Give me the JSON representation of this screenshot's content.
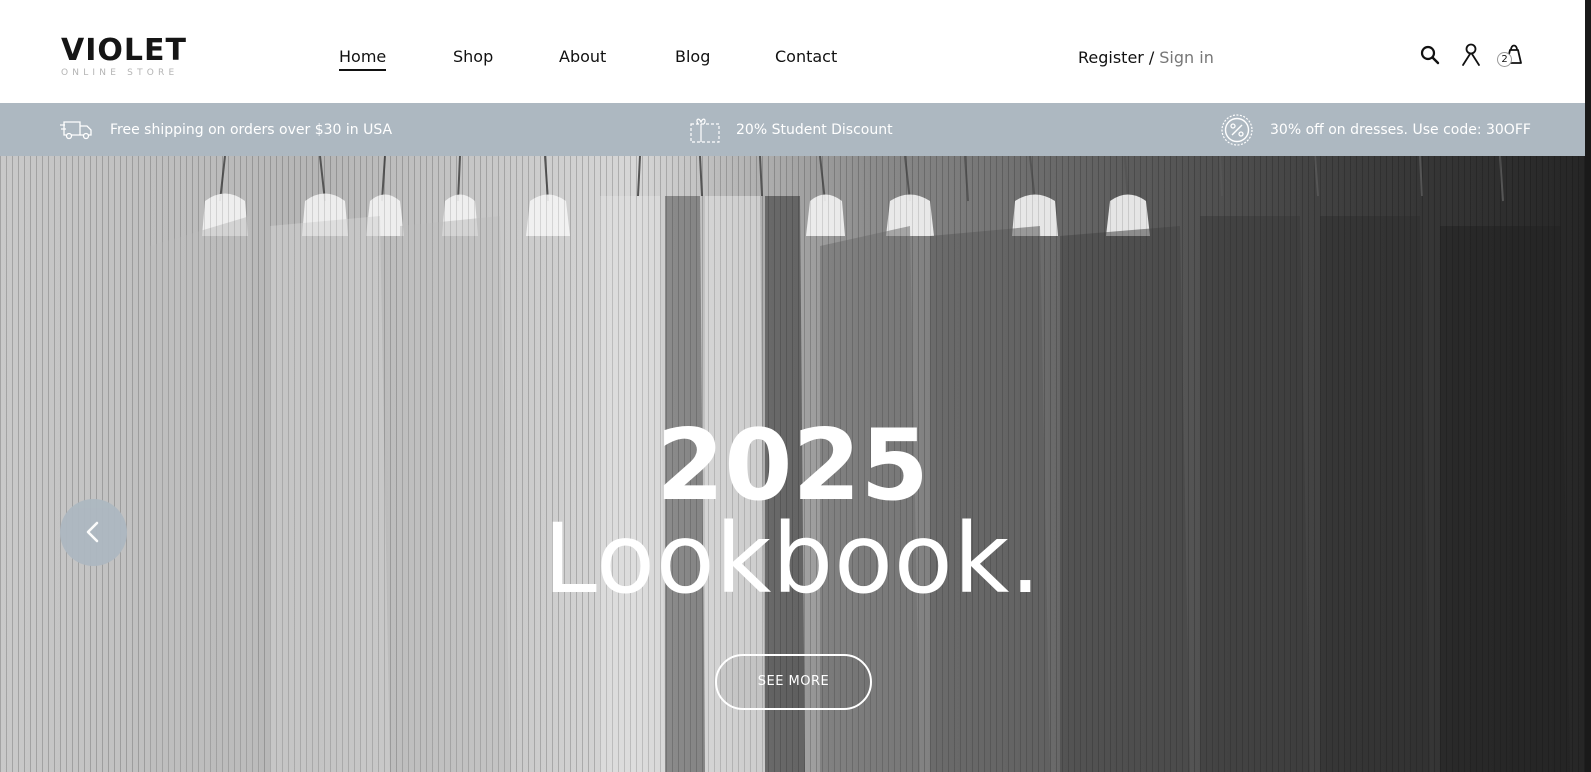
{
  "logo": {
    "title": "VIOLET",
    "subtitle": "ONLINE STORE"
  },
  "nav": {
    "items": [
      {
        "label": "Home",
        "active": true
      },
      {
        "label": "Shop",
        "active": false
      },
      {
        "label": "About",
        "active": false
      },
      {
        "label": "Blog",
        "active": false
      },
      {
        "label": "Contact",
        "active": false
      }
    ]
  },
  "auth": {
    "register": "Register",
    "separator": "/",
    "signin": "Sign in"
  },
  "header_icons": {
    "search": "search-icon",
    "account": "user-icon",
    "cart": "shopping-bag-icon",
    "cart_count": "2"
  },
  "promo": {
    "items": [
      {
        "icon": "delivery-truck-icon",
        "text": "Free shipping on orders over $30 in USA"
      },
      {
        "icon": "gift-coupon-icon",
        "text": "20% Student Discount"
      },
      {
        "icon": "percent-badge-icon",
        "text": "30% off on dresses. Use code: 30OFF"
      }
    ]
  },
  "hero": {
    "year": "2025",
    "title": "Lookbook.",
    "button": "SEE MORE",
    "prev_icon": "chevron-left-icon"
  },
  "colors": {
    "promo_bg": "#adb8c1",
    "text_dark": "#111111",
    "muted": "#777777"
  }
}
